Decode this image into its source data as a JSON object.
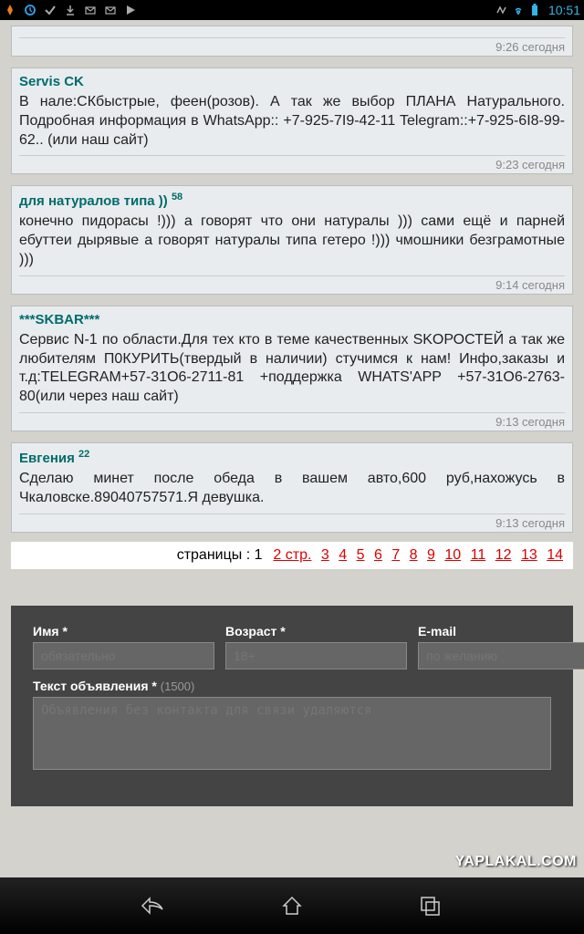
{
  "status": {
    "time": "10:51"
  },
  "posts": [
    {
      "title": "",
      "sup": "",
      "body": "",
      "time": "9:26 сегодня"
    },
    {
      "title": "Servis CK",
      "sup": "",
      "body": "В нале:СКбыстрые, феен(розов). А так же выбор ПЛАНА Натурального. Подробная информация в WhatsApp:: +7-925-7I9-42-11 Telegram::+7-925-6I8-99-62.. (или наш сайт)",
      "time": "9:23 сегодня"
    },
    {
      "title": "для натуралов типа ))",
      "sup": "58",
      "body": "конечно пидорасы !))) а говорят что они натуралы ))) сами ещё и парней ебуттеи дырявые а говорят натуралы типа гетеро !))) чмошники безграмотные )))",
      "time": "9:14 сегодня"
    },
    {
      "title": "***SKBAR***",
      "sup": "",
      "body": "Сервис N-1 по области.Для тех кто в теме качественных SKОРОСТЕЙ а так же любителям П0КУРИТЬ(твердый в наличии) стучимся к нам! Инфо,заказы и т.д:TELEGRAM+57-31О6-2711-81 +поддержка WHATS'APP +57-31О6-2763-80(или через наш сайт)",
      "time": "9:13 сегодня"
    },
    {
      "title": "Евгения",
      "sup": "22",
      "body": "Сделаю минет после обеда в вашем авто,600 руб,нахожусь в Чкаловске.89040757571.Я девушка.",
      "time": "9:13 сегодня"
    }
  ],
  "pagination": {
    "label": "страницы :",
    "current": "1",
    "links": [
      "2 стр.",
      "3",
      "4",
      "5",
      "6",
      "7",
      "8",
      "9",
      "10",
      "11",
      "12",
      "13",
      "14"
    ]
  },
  "form": {
    "name_label": "Имя *",
    "name_placeholder": "обязательно",
    "age_label": "Возраст *",
    "age_placeholder": "18+",
    "email_label": "E-mail",
    "email_placeholder": "по желанию",
    "text_label": "Текст объявления *",
    "char_count": "(1500)",
    "text_placeholder": "Объявления без контакта для связи удаляются"
  },
  "watermark": "YAPLAKAL.COM"
}
